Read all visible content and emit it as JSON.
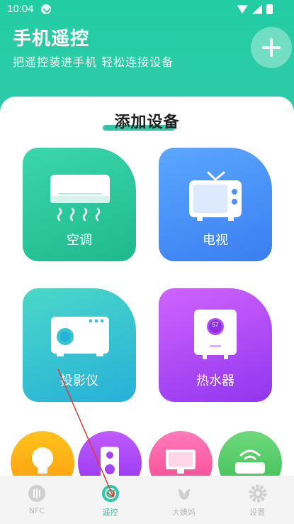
{
  "status_bar": {
    "time": "10:04"
  },
  "header": {
    "title": "手机遥控",
    "subtitle": "把遥控装进手机 轻松连接设备",
    "add_icon": "plus-icon"
  },
  "section": {
    "title": "添加设备"
  },
  "devices": [
    {
      "label": "空调",
      "icon": "air-conditioner-icon",
      "color": "#2ccb9f"
    },
    {
      "label": "电视",
      "icon": "tv-icon",
      "color": "#4a91f9"
    },
    {
      "label": "投影仪",
      "icon": "projector-icon",
      "color": "#37c4d1"
    },
    {
      "label": "热水器",
      "icon": "water-heater-icon",
      "color": "#b04cf6"
    }
  ],
  "more_devices": [
    {
      "icon": "light-bulb-icon",
      "color": "#ffae17"
    },
    {
      "icon": "speaker-icon",
      "color": "#a844f5"
    },
    {
      "icon": "monitor-icon",
      "color": "#f85a9d"
    },
    {
      "icon": "router-icon",
      "color": "#52c968"
    }
  ],
  "heater_display": "57",
  "nav": [
    {
      "label": "NFC",
      "icon": "nfc-icon",
      "active": false
    },
    {
      "label": "遥控",
      "icon": "remote-icon",
      "active": true
    },
    {
      "label": "大姨妈",
      "icon": "flower-icon",
      "active": false
    },
    {
      "label": "设置",
      "icon": "settings-icon",
      "active": false
    }
  ],
  "colors": {
    "accent": "#2fc7a5",
    "header": "#22cda3",
    "nav_inactive": "#b6b6b6"
  }
}
